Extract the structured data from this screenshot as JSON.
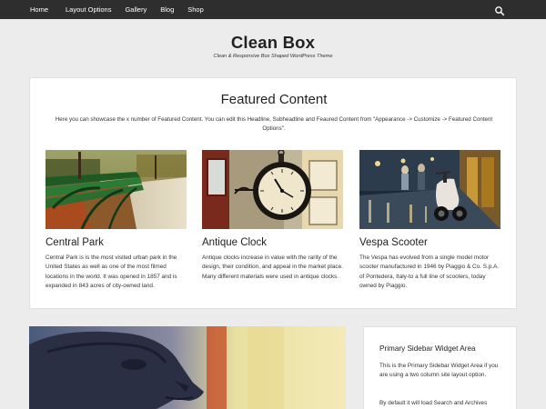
{
  "nav": {
    "items": [
      "Home",
      "Layout Options",
      "Gallery",
      "Blog",
      "Shop"
    ],
    "search_icon": "search-icon"
  },
  "site": {
    "title": "Clean Box",
    "tagline": "Clean & Responsive Box Shaped WordPress Theme"
  },
  "featured": {
    "title": "Featured Content",
    "description": "Here you can showcase the x number of Featured Content. You can edit this Headline, Subheadline and Feaured Content from \"Appearance -> Customize -> Featured Content Options\".",
    "cards": [
      {
        "title": "Central Park",
        "text": "Central Park is is the most visited urban park in the United States as well as one of the most filmed locations in the world. It was opened in 1857 and is expanded in 843 acres of city-owned land."
      },
      {
        "title": "Antique Clock",
        "text": "Antique clocks increase in value with the rarity of the design, their condition, and appeal in the market place. Many different materials were used in antique clocks."
      },
      {
        "title": "Vespa Scooter",
        "text": "The Vespa has evolved from a single model motor scooter manufactured in 1946 by Piaggio & Co. S.p.A. of Pontedera, Italy-to a full line of scooters, today owned by Piaggio."
      }
    ]
  },
  "sidebar": {
    "title": "Primary Sidebar Widget Area",
    "text1": "This is the Primary Sidebar Widget Area if you are using a two column site layout option.",
    "text2": "By default it will load Search and Archives"
  }
}
